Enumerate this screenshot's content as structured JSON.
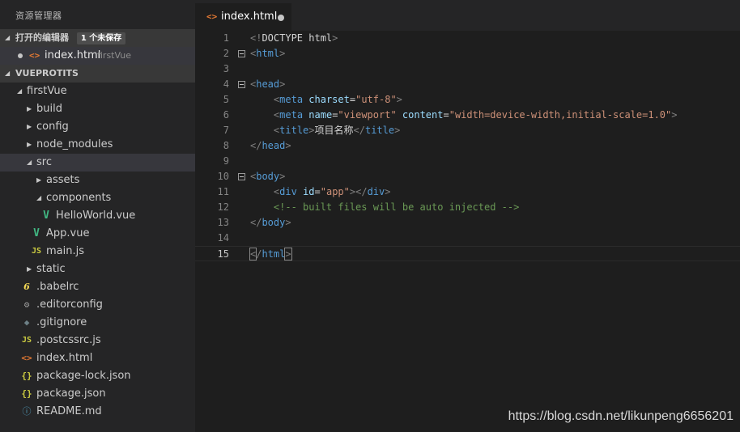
{
  "explorer": {
    "title": "资源管理器",
    "open_editors": {
      "header": "打开的编辑器",
      "badge": "1 个未保存",
      "items": [
        {
          "icon": "html-icon",
          "name": "index.html",
          "folder": "firstVue",
          "dirty": true
        }
      ]
    },
    "project": {
      "header": "VUEPROTITS",
      "tree": [
        {
          "label": "firstVue",
          "kind": "folder",
          "expanded": true
        },
        {
          "label": "build",
          "kind": "folder",
          "expanded": false
        },
        {
          "label": "config",
          "kind": "folder",
          "expanded": false
        },
        {
          "label": "node_modules",
          "kind": "folder",
          "expanded": false
        },
        {
          "label": "src",
          "kind": "folder",
          "expanded": true,
          "selected": true
        },
        {
          "label": "assets",
          "kind": "folder",
          "expanded": false
        },
        {
          "label": "components",
          "kind": "folder",
          "expanded": true
        },
        {
          "label": "HelloWorld.vue",
          "kind": "file",
          "icon": "vue-icon"
        },
        {
          "label": "App.vue",
          "kind": "file",
          "icon": "vue-icon"
        },
        {
          "label": "main.js",
          "kind": "file",
          "icon": "js-icon"
        },
        {
          "label": "static",
          "kind": "folder",
          "expanded": false
        },
        {
          "label": ".babelrc",
          "kind": "file",
          "icon": "babel-icon"
        },
        {
          "label": ".editorconfig",
          "kind": "file",
          "icon": "gear-icon"
        },
        {
          "label": ".gitignore",
          "kind": "file",
          "icon": "git-icon"
        },
        {
          "label": ".postcssrc.js",
          "kind": "file",
          "icon": "js-icon"
        },
        {
          "label": "index.html",
          "kind": "file",
          "icon": "html-icon"
        },
        {
          "label": "package-lock.json",
          "kind": "file",
          "icon": "json-icon"
        },
        {
          "label": "package.json",
          "kind": "file",
          "icon": "json-icon"
        },
        {
          "label": "README.md",
          "kind": "file",
          "icon": "info-icon"
        }
      ]
    }
  },
  "icons": {
    "folder_expanded": "◢",
    "folder_collapsed": "▶",
    "html-icon": "<>",
    "vue-icon": "V",
    "js-icon": "JS",
    "babel-icon": "6",
    "gear-icon": "⚙",
    "git-icon": "◆",
    "json-icon": "{}",
    "info-icon": "ⓘ"
  },
  "editor": {
    "tabs": [
      {
        "label": "index.html",
        "active": true,
        "dirty": true,
        "icon": "html-icon"
      }
    ],
    "current_line": 15,
    "lines": [
      {
        "n": "1",
        "tokens": [
          [
            "br",
            "<!"
          ],
          [
            "dt",
            "DOCTYPE html"
          ],
          [
            "br",
            ">"
          ]
        ]
      },
      {
        "n": "2",
        "fold": true,
        "tokens": [
          [
            "br",
            "<"
          ],
          [
            "tag",
            "html"
          ],
          [
            "br",
            ">"
          ]
        ]
      },
      {
        "n": "3",
        "tokens": []
      },
      {
        "n": "4",
        "fold": true,
        "tokens": [
          [
            "br",
            "<"
          ],
          [
            "tag",
            "head"
          ],
          [
            "br",
            ">"
          ]
        ]
      },
      {
        "n": "5",
        "tokens": [
          [
            "txt",
            "    "
          ],
          [
            "br",
            "<"
          ],
          [
            "tag",
            "meta"
          ],
          [
            "txt",
            " "
          ],
          [
            "attr",
            "charset"
          ],
          [
            "txt",
            "="
          ],
          [
            "str",
            "\"utf-8\""
          ],
          [
            "br",
            ">"
          ]
        ]
      },
      {
        "n": "6",
        "tokens": [
          [
            "txt",
            "    "
          ],
          [
            "br",
            "<"
          ],
          [
            "tag",
            "meta"
          ],
          [
            "txt",
            " "
          ],
          [
            "attr",
            "name"
          ],
          [
            "txt",
            "="
          ],
          [
            "str",
            "\"viewport\""
          ],
          [
            "txt",
            " "
          ],
          [
            "attr",
            "content"
          ],
          [
            "txt",
            "="
          ],
          [
            "str",
            "\"width=device-width,initial-scale=1.0\""
          ],
          [
            "br",
            ">"
          ]
        ]
      },
      {
        "n": "7",
        "tokens": [
          [
            "txt",
            "    "
          ],
          [
            "br",
            "<"
          ],
          [
            "tag",
            "title"
          ],
          [
            "br",
            ">"
          ],
          [
            "txt",
            "项目名称"
          ],
          [
            "br",
            "</"
          ],
          [
            "tag",
            "title"
          ],
          [
            "br",
            ">"
          ]
        ]
      },
      {
        "n": "8",
        "tokens": [
          [
            "br",
            "</"
          ],
          [
            "tag",
            "head"
          ],
          [
            "br",
            ">"
          ]
        ]
      },
      {
        "n": "9",
        "tokens": []
      },
      {
        "n": "10",
        "fold": true,
        "tokens": [
          [
            "br",
            "<"
          ],
          [
            "tag",
            "body"
          ],
          [
            "br",
            ">"
          ]
        ]
      },
      {
        "n": "11",
        "tokens": [
          [
            "txt",
            "    "
          ],
          [
            "br",
            "<"
          ],
          [
            "tag",
            "div"
          ],
          [
            "txt",
            " "
          ],
          [
            "attr",
            "id"
          ],
          [
            "txt",
            "="
          ],
          [
            "str",
            "\"app\""
          ],
          [
            "br",
            "></"
          ],
          [
            "tag",
            "div"
          ],
          [
            "br",
            ">"
          ]
        ]
      },
      {
        "n": "12",
        "tokens": [
          [
            "txt",
            "    "
          ],
          [
            "cmt",
            "<!-- built files will be auto injected -->"
          ]
        ]
      },
      {
        "n": "13",
        "tokens": [
          [
            "br",
            "</"
          ],
          [
            "tag",
            "body"
          ],
          [
            "br",
            ">"
          ]
        ]
      },
      {
        "n": "14",
        "tokens": []
      },
      {
        "n": "15",
        "tokens": [
          [
            "br",
            "<",
            "bm"
          ],
          [
            "br",
            "/"
          ],
          [
            "tag",
            "html"
          ],
          [
            "br",
            ">",
            "bm"
          ]
        ]
      }
    ]
  },
  "watermark": "https://blog.csdn.net/likunpeng6656201"
}
